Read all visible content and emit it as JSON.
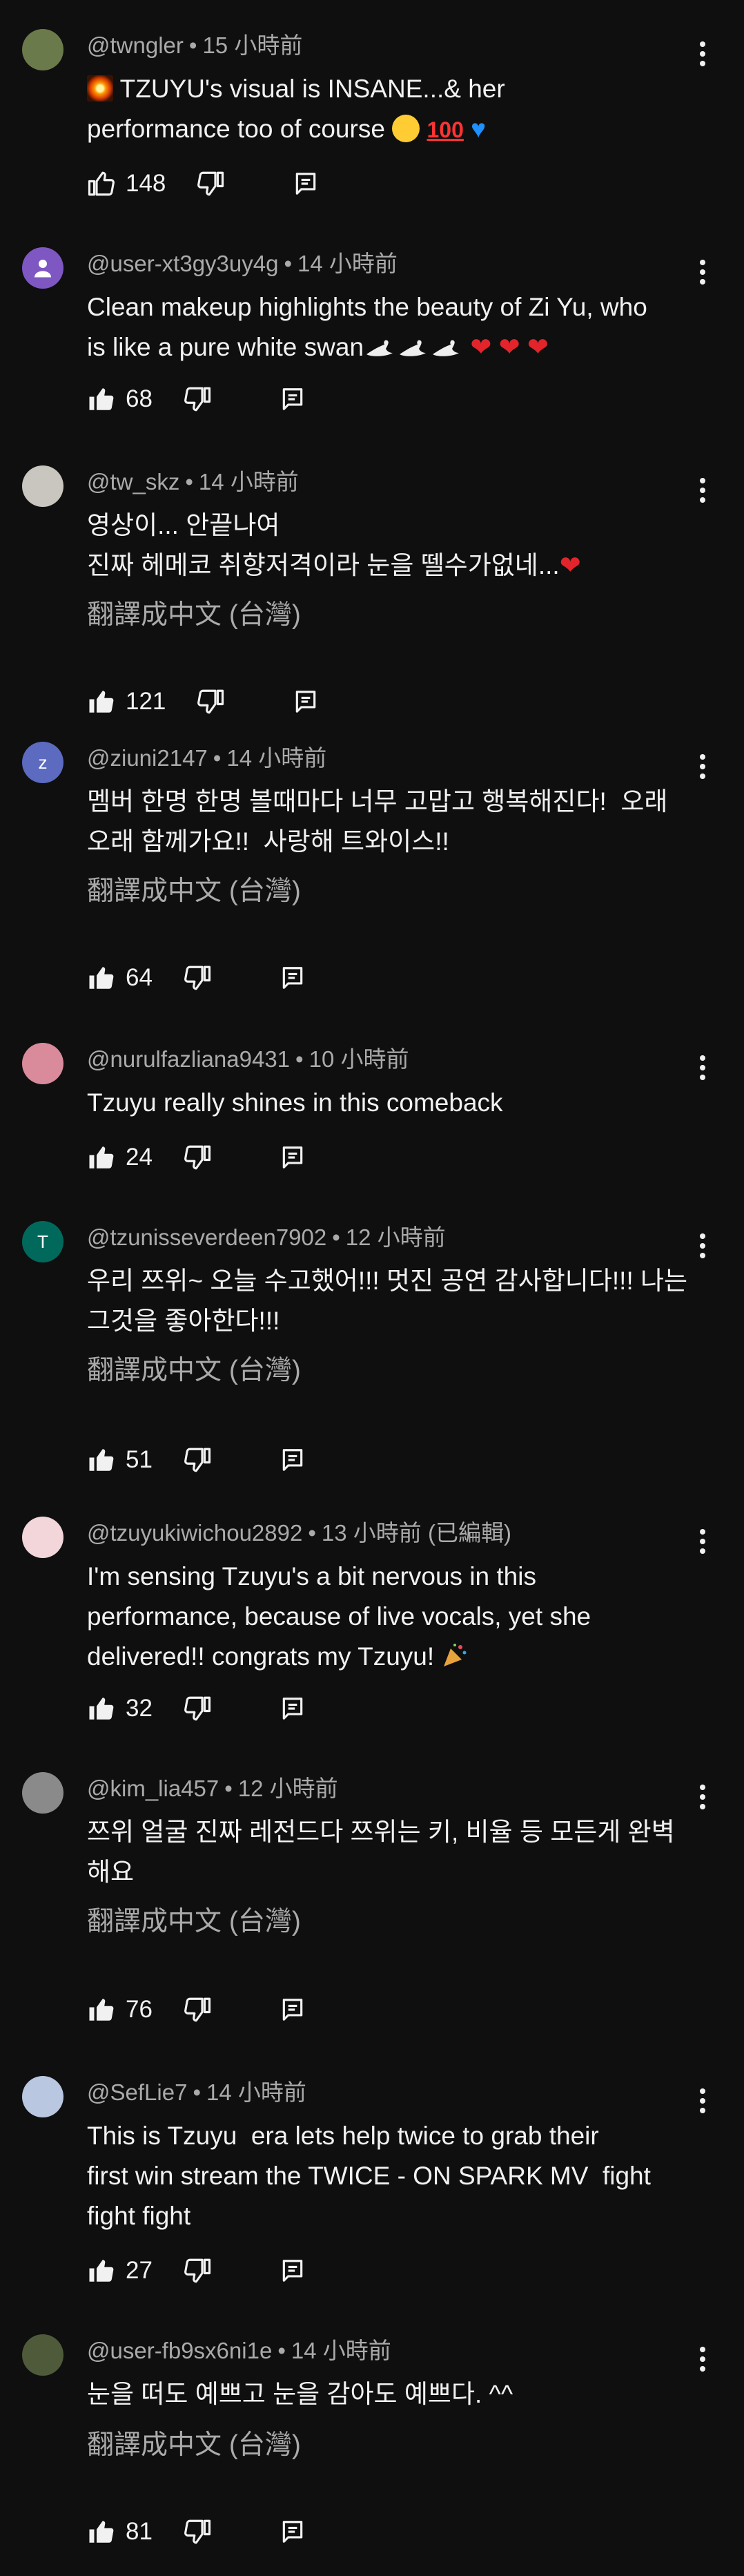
{
  "comments": [
    {
      "username": "@twngler",
      "time": "15 小時前",
      "likes": "148",
      "avatar_color": "#6b7a4a",
      "avatar_initial": "",
      "body": [
        "",
        "TZUYU's visual is INSANE...& her",
        "performance too of course "
      ]
    },
    {
      "username": "@user-xt3gy3uy4g",
      "time": "14 小時前",
      "likes": "68",
      "avatar_color": "#7e57c2",
      "avatar_initial": "",
      "body": [
        "Clean makeup highlights the beauty of Zi Yu, who",
        "is like a pure white swan"
      ]
    },
    {
      "username": "@tw_skz",
      "time": "14 小時前",
      "likes": "121",
      "avatar_color": "#c9c6bf",
      "avatar_initial": "",
      "body": [
        "영상이... 안끝나여",
        "진짜 헤메코 취향저격이라 눈을 뗄수가없네..."
      ],
      "translate": "翻譯成中文 (台灣)"
    },
    {
      "username": "@ziuni2147",
      "time": "14 小時前",
      "likes": "64",
      "avatar_color": "#5c6bc0",
      "avatar_initial": "z",
      "body": [
        "멤버 한명 한명 볼때마다 너무 고맙고 행복해진다!  오래",
        "오래 함께가요!!  사랑해 트와이스!!"
      ],
      "translate": "翻譯成中文 (台灣)"
    },
    {
      "username": "@nurulfazliana9431",
      "time": "10 小時前",
      "likes": "24",
      "avatar_color": "#d98b9b",
      "avatar_initial": "",
      "body": [
        "Tzuyu really shines in this comeback"
      ]
    },
    {
      "username": "@tzunisseverdeen7902",
      "time": "12 小時前",
      "likes": "51",
      "avatar_color": "#00695c",
      "avatar_initial": "T",
      "body": [
        "우리 쯔위~ 오늘 수고했어!!! 멋진 공연 감사합니다!!! 나는",
        "그것을 좋아한다!!!"
      ],
      "translate": "翻譯成中文 (台灣)"
    },
    {
      "username": "@tzuyukiwichou2892",
      "time": "13 小時前",
      "edited": "(已編輯)",
      "likes": "32",
      "avatar_color": "#f3d6da",
      "avatar_initial": "",
      "body": [
        "I'm sensing Tzuyu's a bit nervous in this",
        "performance, because of live vocals, yet she",
        "delivered!! congrats my Tzuyu! "
      ]
    },
    {
      "username": "@kim_lia457",
      "time": "12 小時前",
      "likes": "76",
      "avatar_color": "#8a8a8a",
      "avatar_initial": "",
      "body": [
        "쯔위 얼굴 진짜 레전드다 쯔위는 키, 비율 등 모든게 완벽",
        "해요"
      ],
      "translate": "翻譯成中文 (台灣)"
    },
    {
      "username": "@SefLie7",
      "time": "14 小時前",
      "likes": "27",
      "avatar_color": "#b9c7e0",
      "avatar_initial": "",
      "body": [
        "This is Tzuyu  era lets help twice to grab their",
        "first win stream the TWICE - ON SPARK MV  fight",
        "fight fight"
      ]
    },
    {
      "username": "@user-fb9sx6ni1e",
      "time": "14 小時前",
      "likes": "81",
      "avatar_color": "#4e5a3a",
      "avatar_initial": "",
      "body": [
        "눈을 떠도 예쁘고 눈을 감아도 예쁘다. ^^"
      ],
      "translate": "翻譯成中文 (台灣)"
    }
  ],
  "icons": {
    "like": "thumbs-up-icon",
    "dislike": "thumbs-down-icon",
    "reply": "reply-icon",
    "menu": "more-vert-icon"
  }
}
